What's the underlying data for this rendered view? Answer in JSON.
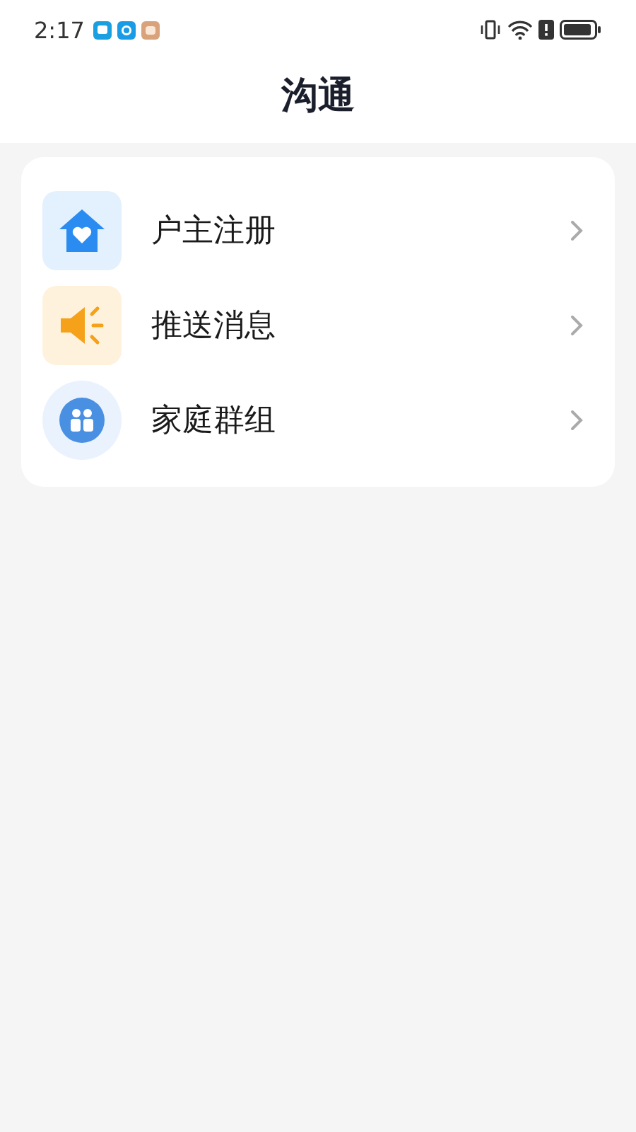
{
  "status_bar": {
    "time": "2:17"
  },
  "header": {
    "title": "沟通"
  },
  "menu": [
    {
      "kind": "house",
      "label": "户主注册"
    },
    {
      "kind": "speaker",
      "label": "推送消息"
    },
    {
      "kind": "group",
      "label": "家庭群组"
    }
  ]
}
